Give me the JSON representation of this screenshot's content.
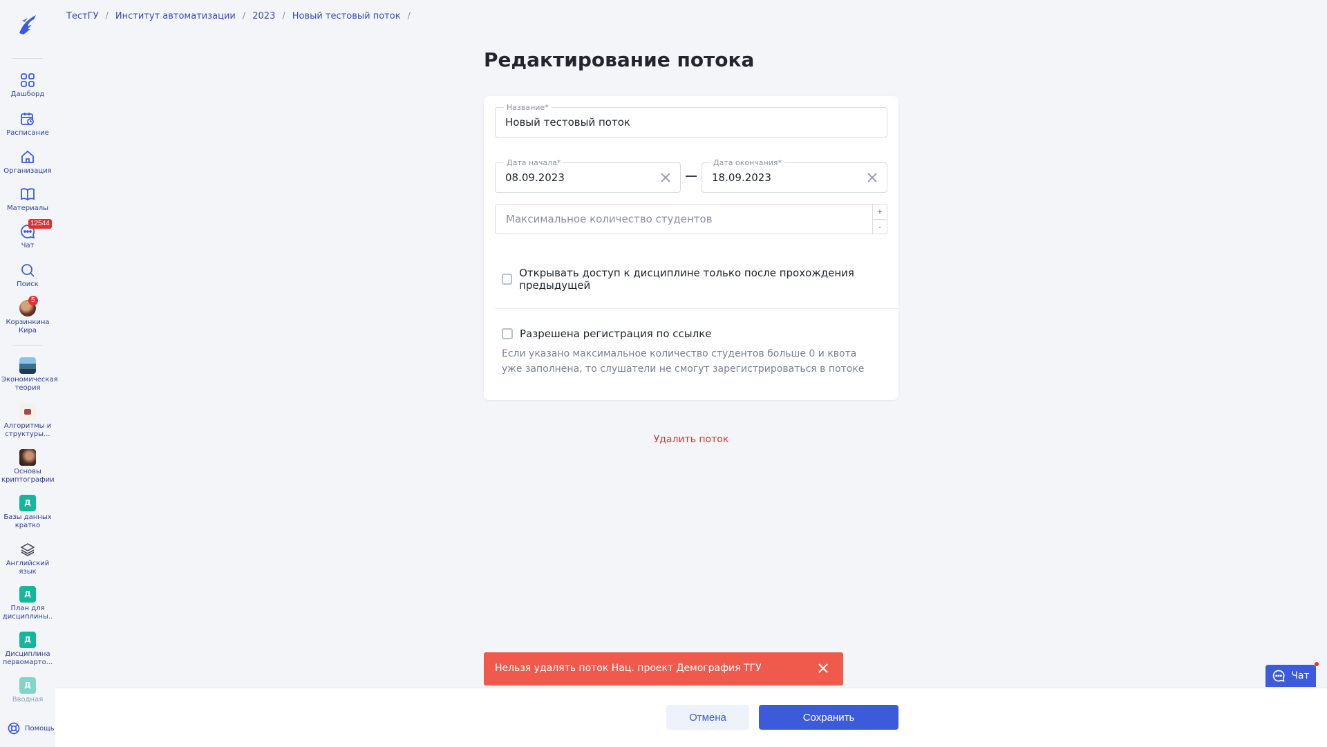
{
  "breadcrumb": [
    "ТестГУ",
    "Институт автоматизации",
    "2023",
    "Новый тестовый поток"
  ],
  "sidebar": {
    "nav": [
      {
        "label": "Дашборд",
        "icon": "dashboard-icon"
      },
      {
        "label": "Расписание",
        "icon": "calendar-icon"
      },
      {
        "label": "Организация",
        "icon": "home-icon"
      },
      {
        "label": "Материалы",
        "icon": "book-icon"
      },
      {
        "label": "Чат",
        "icon": "chat-icon",
        "badge": "12544"
      },
      {
        "label": "Поиск",
        "icon": "search-icon"
      },
      {
        "label": "Корзинкина Кира",
        "icon": "avatar",
        "badge": "5"
      }
    ],
    "courses": [
      {
        "label": "Экономическая теория"
      },
      {
        "label": "Алгоритмы и структуры..."
      },
      {
        "label": "Основы криптографии"
      },
      {
        "label": "Базы данных кратко",
        "letter": "Д"
      },
      {
        "label": "Английский язык"
      },
      {
        "label": "План для дисциплины..",
        "letter": "Д"
      },
      {
        "label": "Дисциплина первомарто...",
        "letter": "Д"
      },
      {
        "label": "Вводная",
        "letter": "Д"
      }
    ],
    "help_label": "Помощь"
  },
  "page": {
    "title": "Редактирование потока"
  },
  "form": {
    "name_legend": "Название*",
    "name_value": "Новый тестовый поток",
    "start_legend": "Дата начала*",
    "start_value": "08.09.2023",
    "end_legend": "Дата окончания*",
    "end_value": "18.09.2023",
    "max_students_placeholder": "Максимальное количество студентов",
    "step_plus": "+",
    "step_minus": "-",
    "checkbox_sequential": "Открывать доступ к дисциплине только после прохождения предыдущей",
    "checkbox_registration": "Разрешена регистрация по ссылке",
    "hint": "Если указано максимальное количество студентов больше 0 и квота уже заполнена, то слушатели не смогут зарегистрироваться в потоке"
  },
  "delete_label": "Удалить поток",
  "toast": {
    "text": "Нельзя удалять поток Нац. проект Демография ТГУ"
  },
  "actions": {
    "cancel_label": "Отмена",
    "save_label": "Сохранить"
  },
  "chat_widget": {
    "label": "Чат"
  },
  "colors": {
    "accent": "#3b5bdb",
    "danger": "#e03131",
    "toast": "#ef5a4c",
    "teal": "#13b79a"
  }
}
